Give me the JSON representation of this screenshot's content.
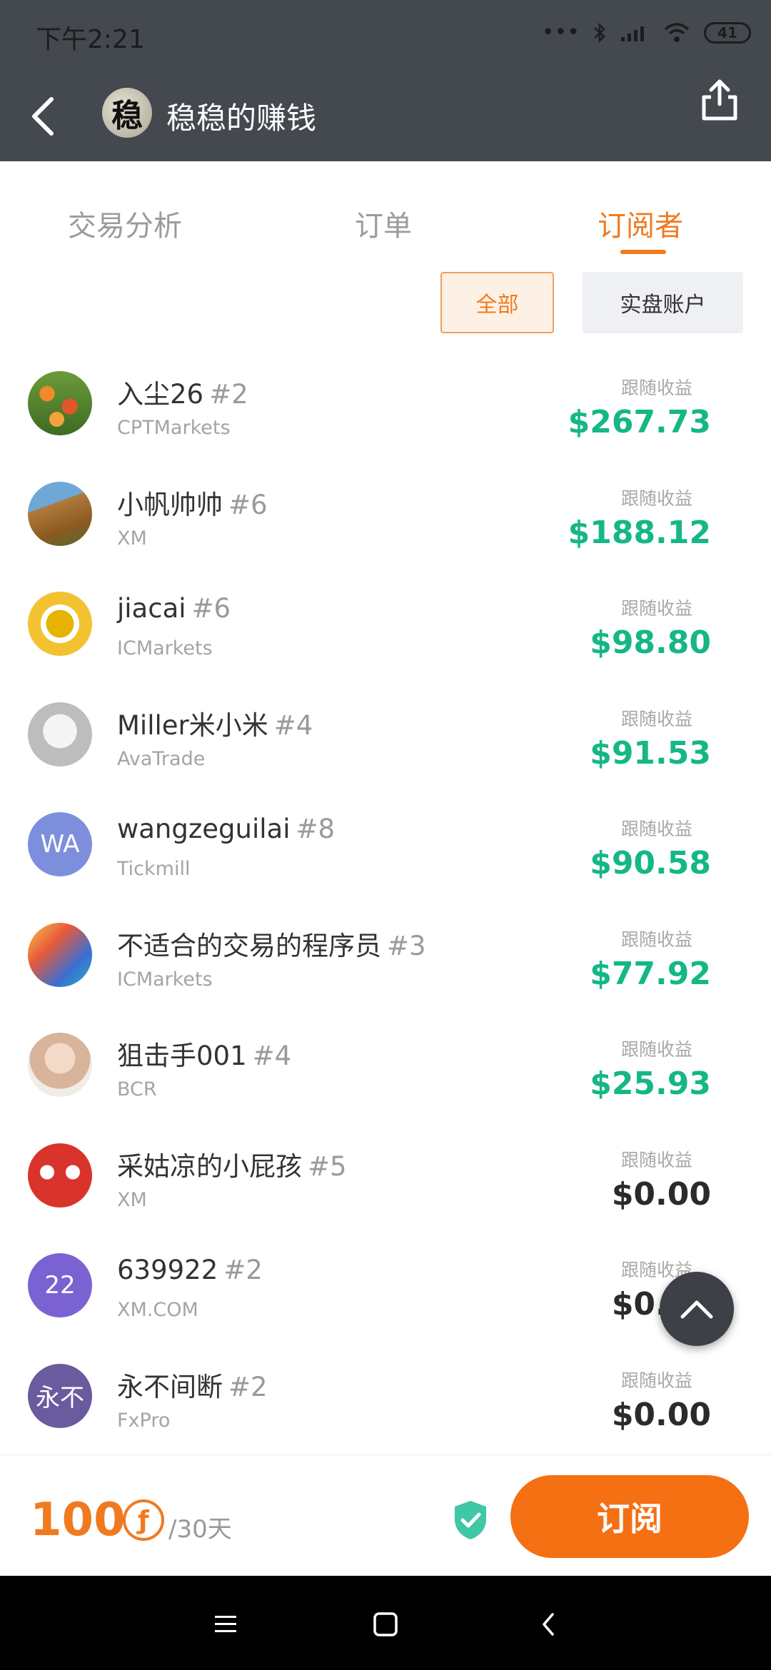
{
  "status_bar": {
    "time": "下午2:21",
    "battery": "41"
  },
  "header": {
    "avatar_text": "稳",
    "title": "稳稳的赚钱"
  },
  "tabs": [
    {
      "label": "交易分析",
      "active": false
    },
    {
      "label": "订单",
      "active": false
    },
    {
      "label": "订阅者",
      "active": true
    }
  ],
  "filters": {
    "all": "全部",
    "real": "实盘账户"
  },
  "gain_label": "跟随收益",
  "subscribers": [
    {
      "name": "入尘26",
      "rank": "#2",
      "broker": "CPTMarkets",
      "gain": "$267.73",
      "avatar": "tulips"
    },
    {
      "name": "小帆帅帅",
      "rank": "#6",
      "broker": "XM",
      "gain": "$188.12",
      "avatar": "mountain"
    },
    {
      "name": "jiacai",
      "rank": "#6",
      "broker": "ICMarkets",
      "gain": "$98.80",
      "avatar": "gold"
    },
    {
      "name": "Miller米小米",
      "rank": "#4",
      "broker": "AvaTrade",
      "gain": "$91.53",
      "avatar": "anime-girl"
    },
    {
      "name": "wangzeguilai",
      "rank": "#8",
      "broker": "Tickmill",
      "gain": "$90.58",
      "avatar": "initials",
      "initials": "WA"
    },
    {
      "name": "不适合的交易的程序员",
      "rank": "#3",
      "broker": "ICMarkets",
      "gain": "$77.92",
      "avatar": "anime-colorful"
    },
    {
      "name": "狙击手001",
      "rank": "#4",
      "broker": "BCR",
      "gain": "$25.93",
      "avatar": "sunglasses-girl"
    },
    {
      "name": "采姑凉的小屁孩",
      "rank": "#5",
      "broker": "XM",
      "gain": "$0.00",
      "avatar": "mask"
    },
    {
      "name": "639922",
      "rank": "#2",
      "broker": "XM.COM",
      "gain": "$0.00",
      "avatar": "initials",
      "initials": "22"
    },
    {
      "name": "永不间断",
      "rank": "#2",
      "broker": "FxPro",
      "gain": "$0.00",
      "avatar": "initials",
      "initials": "永不"
    }
  ],
  "bottom": {
    "price": "100",
    "coin_symbol": "ƒ",
    "period": "/30天",
    "subscribe_label": "订阅"
  },
  "colors": {
    "accent": "#f07a20",
    "gain_positive": "#14b785",
    "header_bg": "#44484f"
  }
}
